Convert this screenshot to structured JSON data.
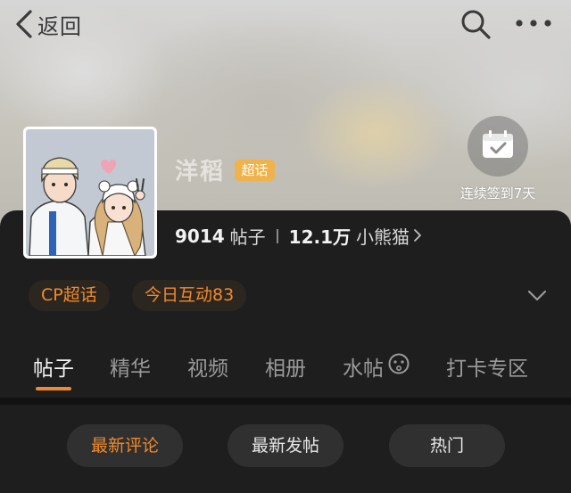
{
  "header": {
    "back_label": "返回",
    "icons": [
      "chevron-left-icon",
      "search-icon",
      "more-icon"
    ]
  },
  "topic": {
    "name": "洋稻",
    "badge": "超话",
    "checkin_label": "连续签到7天",
    "posts_count": "9014",
    "posts_unit": "帖子",
    "followers_count": "12.1万",
    "followers_unit": "小熊猫"
  },
  "tags": [
    "CP超话",
    "今日互动83"
  ],
  "tabs": [
    {
      "label": "帖子",
      "active": true
    },
    {
      "label": "精华",
      "active": false
    },
    {
      "label": "视频",
      "active": false
    },
    {
      "label": "相册",
      "active": false
    },
    {
      "label": "水帖",
      "active": false
    },
    {
      "label": "打卡专区",
      "active": false
    }
  ],
  "sort_buttons": [
    {
      "label": "最新评论",
      "active": true
    },
    {
      "label": "最新发帖",
      "active": false
    },
    {
      "label": "热门",
      "active": false
    }
  ],
  "colors": {
    "accent": "#f08a2c",
    "badge": "#f0b24a",
    "panel_bg": "#1e1e1e"
  }
}
